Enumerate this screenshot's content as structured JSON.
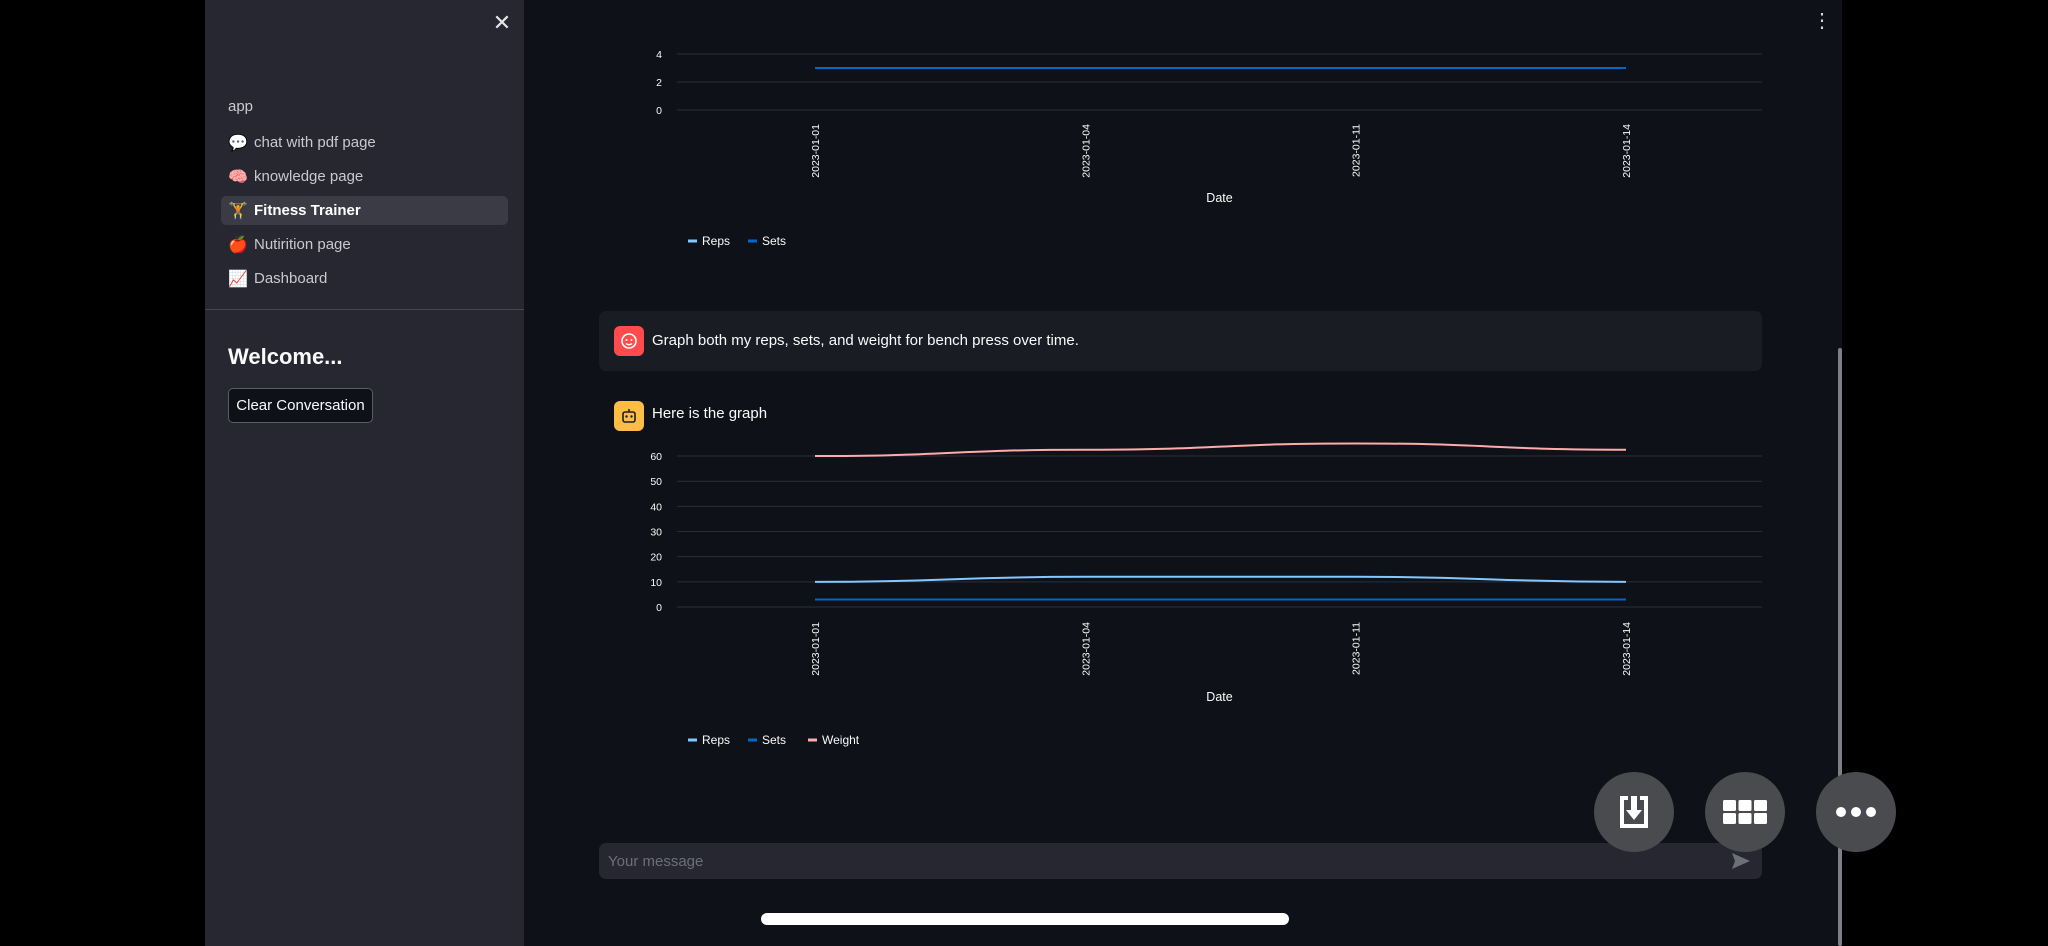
{
  "sidebar": {
    "app_label": "app",
    "nav": [
      {
        "emoji": "💬",
        "label": "chat with pdf page"
      },
      {
        "emoji": "🧠",
        "label": "knowledge page"
      },
      {
        "emoji": "🏋",
        "label": "Fitness Trainer"
      },
      {
        "emoji": "🍎",
        "label": "Nutirition page"
      },
      {
        "emoji": "📈",
        "label": "Dashboard"
      }
    ],
    "active_index": 2,
    "welcome": "Welcome...",
    "clear_button": "Clear Conversation",
    "close_glyph": "✕"
  },
  "main": {
    "menu_glyph": "⋮",
    "user_message": "Graph both my reps, sets, and weight for bench press over time.",
    "assistant_message": "Here is the graph",
    "input_placeholder": "Your message"
  },
  "icons": {
    "close": "close-icon",
    "menu": "more-vertical-icon",
    "user_avatar": "user-face-icon",
    "bot_avatar": "robot-icon",
    "send": "send-icon",
    "download": "download-icon",
    "grid": "grid-icon",
    "more": "more-horizontal-icon"
  },
  "colors": {
    "reps": "#83c9ff",
    "sets": "#0068c9",
    "weight": "#ffabab",
    "user_avatar": "#ff4b4b",
    "bot_avatar": "#ffbd45"
  },
  "chart_data": [
    {
      "type": "line",
      "x": [
        "2023-01-01",
        "2023-01-04",
        "2023-01-11",
        "2023-01-14"
      ],
      "xlabel": "Date",
      "ylabel": "",
      "y_ticks": [
        0,
        2,
        4
      ],
      "ylim": [
        0,
        4
      ],
      "grid": true,
      "legend_position": "bottom-left",
      "series": [
        {
          "name": "Reps",
          "values": []
        },
        {
          "name": "Sets",
          "values": [
            3,
            3,
            3,
            3
          ]
        }
      ]
    },
    {
      "type": "line",
      "x": [
        "2023-01-01",
        "2023-01-04",
        "2023-01-11",
        "2023-01-14"
      ],
      "xlabel": "Date",
      "ylabel": "",
      "y_ticks": [
        0,
        10,
        20,
        30,
        40,
        50,
        60
      ],
      "ylim": [
        0,
        62
      ],
      "grid": true,
      "legend_position": "bottom-left",
      "series": [
        {
          "name": "Reps",
          "values": [
            10,
            12,
            12,
            10
          ]
        },
        {
          "name": "Sets",
          "values": [
            3,
            3,
            3,
            3
          ]
        },
        {
          "name": "Weight",
          "values": [
            60,
            62.5,
            65,
            62.5
          ]
        }
      ]
    }
  ]
}
